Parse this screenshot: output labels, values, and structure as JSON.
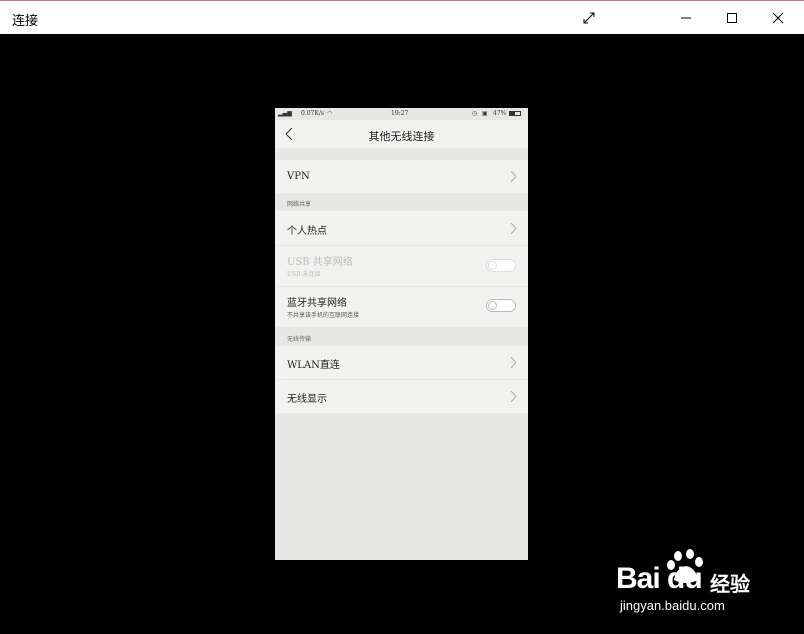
{
  "window": {
    "title": "连接",
    "icons": [
      "expand-icon",
      "minimize-icon",
      "maximize-icon",
      "close-icon"
    ]
  },
  "phone": {
    "status": {
      "left": "0.07K/s",
      "time": "19:27",
      "battery": "47%"
    },
    "nav": {
      "title": "其他无线连接"
    },
    "items": [
      {
        "label": "VPN"
      }
    ],
    "sections": [
      {
        "header": "网络共享",
        "items": [
          {
            "label": "个人热点",
            "type": "link"
          },
          {
            "label": "USB 共享网络",
            "sub": "USB 未连接",
            "type": "toggle",
            "enabled": false,
            "on": false
          },
          {
            "label": "蓝牙共享网络",
            "sub": "不共享该手机的互联网连接",
            "type": "toggle",
            "enabled": true,
            "on": false
          }
        ]
      },
      {
        "header": "无线传输",
        "items": [
          {
            "label": "WLAN直连",
            "type": "link"
          },
          {
            "label": "无线显示",
            "type": "link"
          }
        ]
      }
    ]
  },
  "watermark": {
    "logo": "Bai du",
    "text": "经验",
    "url": "jingyan.baidu.com"
  }
}
